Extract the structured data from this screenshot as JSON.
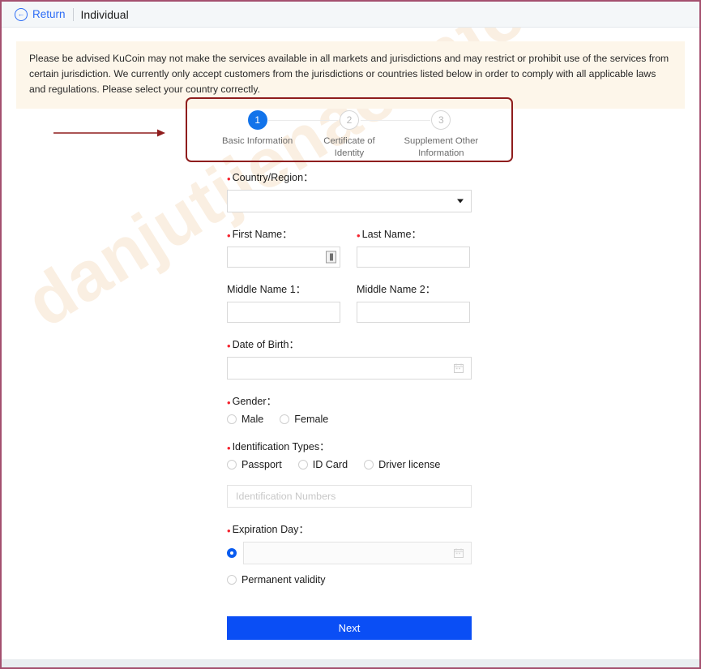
{
  "header": {
    "back_label": "Return",
    "back_icon": "back-arrow-circle-icon",
    "title": "Individual"
  },
  "notice": {
    "text": "Please be advised KuCoin may not make the services available in all markets and jurisdictions and may restrict or prohibit use of the services from certain jurisdiction. We currently only accept customers from the jurisdictions or countries listed below in order to comply with all applicable laws and regulations. Please select your country correctly."
  },
  "stepper": {
    "steps": [
      {
        "number": "1",
        "label": "Basic Information",
        "state": "active"
      },
      {
        "number": "2",
        "label": "Certificate of Identity",
        "state": "idle"
      },
      {
        "number": "3",
        "label": "Supplement Other Information",
        "state": "idle"
      }
    ]
  },
  "form": {
    "country": {
      "label": "Country/Region：",
      "value": "",
      "required": true
    },
    "first_name": {
      "label": "First Name：",
      "value": "",
      "required": true
    },
    "last_name": {
      "label": "Last Name：",
      "value": "",
      "required": true
    },
    "middle_name_1": {
      "label": "Middle Name 1：",
      "value": "",
      "required": false
    },
    "middle_name_2": {
      "label": "Middle Name 2：",
      "value": "",
      "required": false
    },
    "date_of_birth": {
      "label": "Date of Birth：",
      "value": "",
      "required": true,
      "icon": "calendar-icon"
    },
    "gender": {
      "label": "Gender：",
      "required": true,
      "options": [
        {
          "label": "Male",
          "selected": false
        },
        {
          "label": "Female",
          "selected": false
        }
      ]
    },
    "identification_types": {
      "label": "Identification Types：",
      "required": true,
      "options": [
        {
          "label": "Passport",
          "selected": false
        },
        {
          "label": "ID Card",
          "selected": false
        },
        {
          "label": "Driver license",
          "selected": false
        }
      ]
    },
    "identification_numbers": {
      "placeholder": "Identification Numbers",
      "value": ""
    },
    "expiration_day": {
      "label": "Expiration Day：",
      "required": true,
      "date_option_selected": true,
      "date_value": "",
      "permanent_label": "Permanent validity",
      "permanent_selected": false
    },
    "next_label": "Next"
  },
  "watermark": {
    "text": "danjutjienao.info"
  },
  "colors": {
    "accent_blue": "#0a4ef5",
    "step_active": "#1273ea",
    "required_red": "#f5222d",
    "annotation_red": "#8f1d1d",
    "page_border": "#a4506f",
    "notice_bg": "#fdf6ea"
  }
}
